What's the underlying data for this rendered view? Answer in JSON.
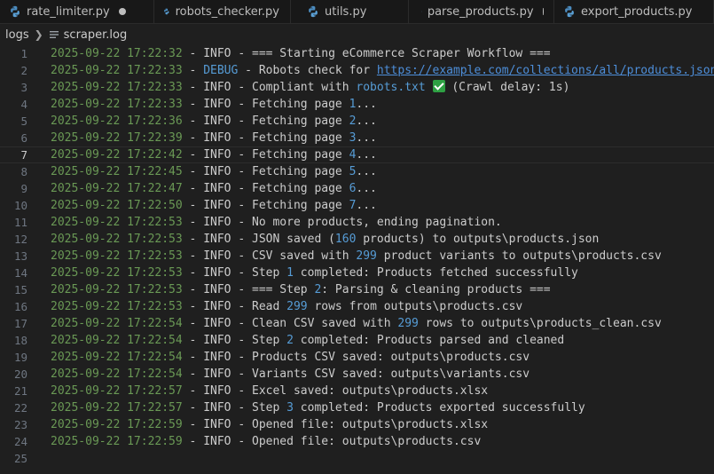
{
  "tabs": [
    {
      "label": "rate_limiter.py",
      "modified": true
    },
    {
      "label": "robots_checker.py",
      "modified": false
    },
    {
      "label": "utils.py",
      "modified": false
    },
    {
      "label": "parse_products.py",
      "modified": true
    },
    {
      "label": "export_products.py",
      "modified": false
    }
  ],
  "breadcrumb": {
    "folder": "logs",
    "file": "scraper.log"
  },
  "colors": {
    "timestamp": "#6a9955",
    "debug": "#569cd6",
    "number": "#569cd6",
    "link": "#4d8ed9"
  },
  "current_line": 7,
  "lines": [
    {
      "n": "1",
      "ts": "2025-09-22 17:22:32",
      "lvl": "INFO",
      "parts": [
        {
          "t": "=== Starting eCommerce Scraper Workflow ==="
        }
      ]
    },
    {
      "n": "2",
      "ts": "2025-09-22 17:22:33",
      "lvl": "DEBUG",
      "parts": [
        {
          "t": "Robots check for "
        },
        {
          "t": "https://example.com/collections/all/products.json",
          "k": "link"
        },
        {
          "t": " ("
        }
      ]
    },
    {
      "n": "3",
      "ts": "2025-09-22 17:22:33",
      "lvl": "INFO",
      "parts": [
        {
          "t": "Compliant with "
        },
        {
          "t": "robots.txt",
          "k": "num"
        },
        {
          "t": " "
        },
        {
          "t": "",
          "k": "check"
        },
        {
          "t": " (Crawl delay: 1s)"
        }
      ]
    },
    {
      "n": "4",
      "ts": "2025-09-22 17:22:33",
      "lvl": "INFO",
      "parts": [
        {
          "t": "Fetching page "
        },
        {
          "t": "1",
          "k": "num"
        },
        {
          "t": "..."
        }
      ]
    },
    {
      "n": "5",
      "ts": "2025-09-22 17:22:36",
      "lvl": "INFO",
      "parts": [
        {
          "t": "Fetching page "
        },
        {
          "t": "2",
          "k": "num"
        },
        {
          "t": "..."
        }
      ]
    },
    {
      "n": "6",
      "ts": "2025-09-22 17:22:39",
      "lvl": "INFO",
      "parts": [
        {
          "t": "Fetching page "
        },
        {
          "t": "3",
          "k": "num"
        },
        {
          "t": "..."
        }
      ]
    },
    {
      "n": "7",
      "ts": "2025-09-22 17:22:42",
      "lvl": "INFO",
      "parts": [
        {
          "t": "Fetching page "
        },
        {
          "t": "4",
          "k": "num"
        },
        {
          "t": "..."
        }
      ]
    },
    {
      "n": "8",
      "ts": "2025-09-22 17:22:45",
      "lvl": "INFO",
      "parts": [
        {
          "t": "Fetching page "
        },
        {
          "t": "5",
          "k": "num"
        },
        {
          "t": "..."
        }
      ]
    },
    {
      "n": "9",
      "ts": "2025-09-22 17:22:47",
      "lvl": "INFO",
      "parts": [
        {
          "t": "Fetching page "
        },
        {
          "t": "6",
          "k": "num"
        },
        {
          "t": "..."
        }
      ]
    },
    {
      "n": "10",
      "ts": "2025-09-22 17:22:50",
      "lvl": "INFO",
      "parts": [
        {
          "t": "Fetching page "
        },
        {
          "t": "7",
          "k": "num"
        },
        {
          "t": "..."
        }
      ]
    },
    {
      "n": "11",
      "ts": "2025-09-22 17:22:53",
      "lvl": "INFO",
      "parts": [
        {
          "t": "No more products, ending pagination."
        }
      ]
    },
    {
      "n": "12",
      "ts": "2025-09-22 17:22:53",
      "lvl": "INFO",
      "parts": [
        {
          "t": "JSON saved ("
        },
        {
          "t": "160",
          "k": "num"
        },
        {
          "t": " products) to outputs\\products.json"
        }
      ]
    },
    {
      "n": "13",
      "ts": "2025-09-22 17:22:53",
      "lvl": "INFO",
      "parts": [
        {
          "t": "CSV saved with "
        },
        {
          "t": "299",
          "k": "num"
        },
        {
          "t": " product variants to outputs\\products.csv"
        }
      ]
    },
    {
      "n": "14",
      "ts": "2025-09-22 17:22:53",
      "lvl": "INFO",
      "parts": [
        {
          "t": "Step "
        },
        {
          "t": "1",
          "k": "num"
        },
        {
          "t": " completed: Products fetched successfully"
        }
      ]
    },
    {
      "n": "15",
      "ts": "2025-09-22 17:22:53",
      "lvl": "INFO",
      "parts": [
        {
          "t": "=== Step "
        },
        {
          "t": "2",
          "k": "num"
        },
        {
          "t": ": Parsing & cleaning products ==="
        }
      ]
    },
    {
      "n": "16",
      "ts": "2025-09-22 17:22:53",
      "lvl": "INFO",
      "parts": [
        {
          "t": "Read "
        },
        {
          "t": "299",
          "k": "num"
        },
        {
          "t": " rows from outputs\\products.csv"
        }
      ]
    },
    {
      "n": "17",
      "ts": "2025-09-22 17:22:54",
      "lvl": "INFO",
      "parts": [
        {
          "t": "Clean CSV saved with "
        },
        {
          "t": "299",
          "k": "num"
        },
        {
          "t": " rows to outputs\\products_clean.csv"
        }
      ]
    },
    {
      "n": "18",
      "ts": "2025-09-22 17:22:54",
      "lvl": "INFO",
      "parts": [
        {
          "t": "Step "
        },
        {
          "t": "2",
          "k": "num"
        },
        {
          "t": " completed: Products parsed and cleaned"
        }
      ]
    },
    {
      "n": "19",
      "ts": "2025-09-22 17:22:54",
      "lvl": "INFO",
      "parts": [
        {
          "t": "Products CSV saved: outputs\\products.csv"
        }
      ]
    },
    {
      "n": "20",
      "ts": "2025-09-22 17:22:54",
      "lvl": "INFO",
      "parts": [
        {
          "t": "Variants CSV saved: outputs\\variants.csv"
        }
      ]
    },
    {
      "n": "21",
      "ts": "2025-09-22 17:22:57",
      "lvl": "INFO",
      "parts": [
        {
          "t": "Excel saved: outputs\\products.xlsx"
        }
      ]
    },
    {
      "n": "22",
      "ts": "2025-09-22 17:22:57",
      "lvl": "INFO",
      "parts": [
        {
          "t": "Step "
        },
        {
          "t": "3",
          "k": "num"
        },
        {
          "t": " completed: Products exported successfully"
        }
      ]
    },
    {
      "n": "23",
      "ts": "2025-09-22 17:22:59",
      "lvl": "INFO",
      "parts": [
        {
          "t": "Opened file: outputs\\products.xlsx"
        }
      ]
    },
    {
      "n": "24",
      "ts": "2025-09-22 17:22:59",
      "lvl": "INFO",
      "parts": [
        {
          "t": "Opened file: outputs\\products.csv"
        }
      ]
    },
    {
      "n": "25",
      "ts": "",
      "lvl": "",
      "parts": []
    }
  ]
}
